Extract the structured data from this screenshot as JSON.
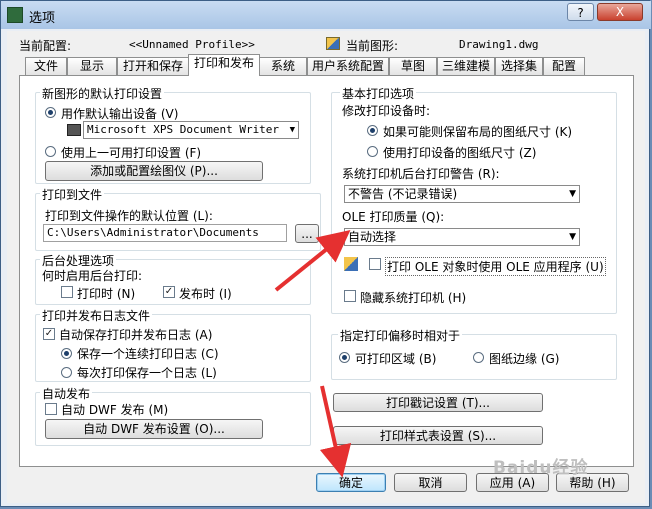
{
  "window": {
    "title": "选项",
    "help_label": "?",
    "close_label": "X"
  },
  "header": {
    "current_profile_label": "当前配置:",
    "current_profile_value": "<<Unnamed Profile>>",
    "current_drawing_label": "当前图形:",
    "current_drawing_value": "Drawing1.dwg"
  },
  "tabs": [
    {
      "label": "文件"
    },
    {
      "label": "显示"
    },
    {
      "label": "打开和保存"
    },
    {
      "label": "打印和发布"
    },
    {
      "label": "系统"
    },
    {
      "label": "用户系统配置"
    },
    {
      "label": "草图"
    },
    {
      "label": "三维建模"
    },
    {
      "label": "选择集"
    },
    {
      "label": "配置"
    }
  ],
  "active_tab": "打印和发布",
  "left": {
    "default_output": {
      "title": "新图形的默认打印设置",
      "use_default_label": "用作默认输出设备 (V)",
      "device_value": "Microsoft XPS Document Writer",
      "use_last_label": "使用上一可用打印设置 (F)",
      "add_plotter_button": "添加或配置绘图仪 (P)..."
    },
    "plot_to_file": {
      "title": "打印到文件",
      "location_label": "打印到文件操作的默认位置 (L):",
      "location_value": "C:\\Users\\Administrator\\Documents",
      "browse_button": "..."
    },
    "background": {
      "title": "后台处理选项",
      "enable_label": "何时启用后台打印:",
      "when_plotting_label": "打印时 (N)",
      "when_publishing_label": "发布时 (I)",
      "publishing_checked_mark": "✓"
    },
    "log": {
      "title": "打印并发布日志文件",
      "auto_save_label": "自动保存打印并发布日志 (A)",
      "auto_save_checked_mark": "✓",
      "continuous_label": "保存一个连续打印日志 (C)",
      "per_plot_label": "每次打印保存一个日志 (L)"
    },
    "auto_publish": {
      "title": "自动发布",
      "auto_dwf_label": "自动 DWF 发布 (M)",
      "settings_button": "自动 DWF 发布设置 (O)..."
    }
  },
  "right": {
    "general": {
      "title": "基本打印选项",
      "modify_label": "修改打印设备时:",
      "keep_layout_label": "如果可能则保留布局的图纸尺寸 (K)",
      "use_device_label": "使用打印设备的图纸尺寸 (Z)",
      "spooler_label": "系统打印机后台打印警告 (R):",
      "spooler_value": "不警告 (不记录错误)",
      "ole_quality_label": "OLE 打印质量 (Q):",
      "ole_quality_value": "自动选择",
      "ole_app_label": "打印 OLE 对象时使用 OLE 应用程序 (U)",
      "hide_system_label": "隐藏系统打印机 (H)"
    },
    "offset": {
      "title": "指定打印偏移时相对于",
      "printable_area_label": "可打印区域 (B)",
      "paper_edge_label": "图纸边缘 (G)"
    },
    "plot_stamp_button": "打印戳记设置 (T)...",
    "plot_style_button": "打印样式表设置 (S)..."
  },
  "footer": {
    "ok": "确定",
    "cancel": "取消",
    "apply": "应用 (A)",
    "help": "帮助 (H)"
  },
  "watermark": "Baidu经验",
  "colors": {
    "annotation_arrow": "#e53030"
  }
}
